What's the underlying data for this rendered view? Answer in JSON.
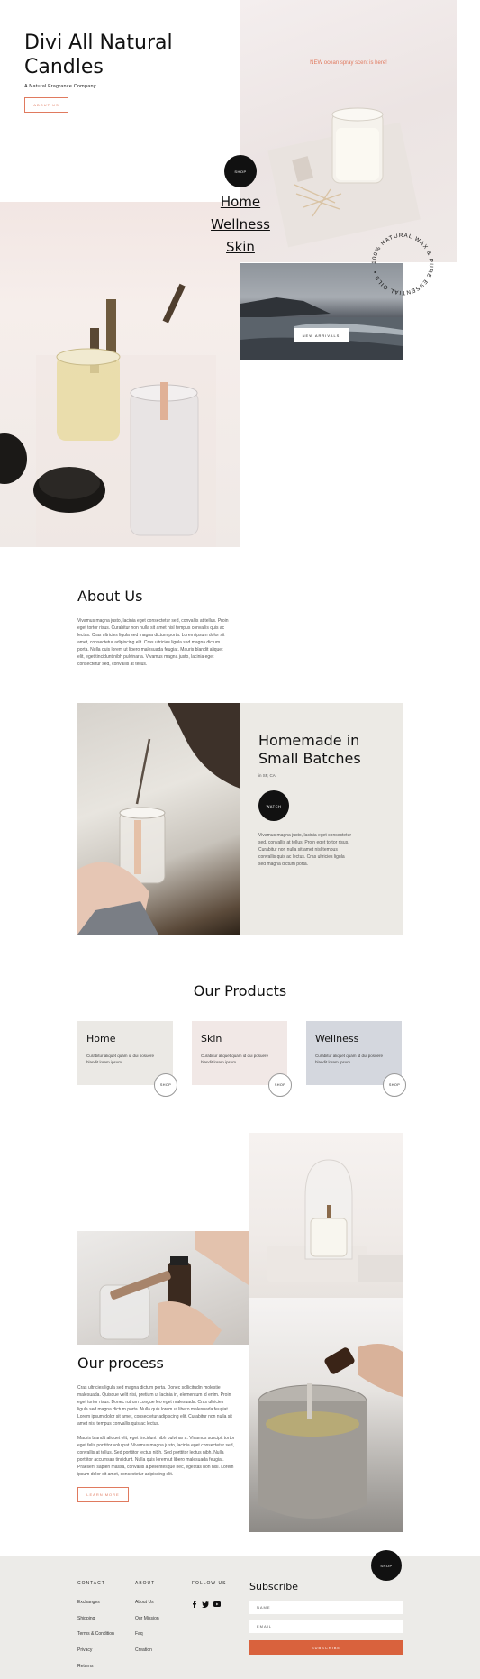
{
  "hero": {
    "title": "Divi All Natural Candles",
    "subtitle": "A Natural Fragrance Company",
    "about_button": "ABOUT US",
    "promo": "NEW ocean spray scent is here!",
    "shop_button": "SHOP",
    "nav": [
      "Home",
      "Wellness",
      "Skin"
    ],
    "new_arrivals_button": "NEW ARRIVALS",
    "circle_text": "100% NATURAL WAX & PURE ESSENTIAL OILS • "
  },
  "about": {
    "title": "About Us",
    "body": "Vivamus magna justo, lacinia eget consectetur sed, convallis at tellus. Proin eget tortor risus. Curabitur non nulla sit amet nisl tempus convallis quis ac lectus. Cras ultricies ligula sed magna dictum porta. Lorem ipsum dolor sit amet, consectetur adipiscing elit. Cras ultricies ligula sed magna dictum porta. Nulla quis lorem ut libero malesuada feugiat. Mauris blandit aliquet elit, eget tincidunt nibh pulvinar a. Vivamus magna justo, lacinia eget consectetur sed, convallis at tellus."
  },
  "homemade": {
    "title": "Homemade in Small Batches",
    "location": "in SF, CA",
    "watch_button": "WATCH",
    "body": "Vivamus magna justo, lacinia eget consectetur sed, convallis at tellus. Proin eget tortor risus. Curabitur non nulla sit amet nisl tempus convallis quis ac lectus. Cras ultricies ligula sed magna dictum porta."
  },
  "products": {
    "title": "Our Products",
    "items": [
      {
        "name": "Home",
        "desc": "Curabitur aliquet quam id dui posuere blandit lorem ipsum.",
        "shop": "SHOP",
        "bg": "#ebe9e5"
      },
      {
        "name": "Skin",
        "desc": "Curabitur aliquet quam id dui posuere blandit lorem ipsum.",
        "shop": "SHOP",
        "bg": "#f1e8e6"
      },
      {
        "name": "Wellness",
        "desc": "Curabitur aliquet quam id dui posuere blandit lorem ipsum.",
        "shop": "SHOP",
        "bg": "#d4d7de"
      }
    ]
  },
  "process": {
    "title": "Our process",
    "body1": "Cras ultricies ligula sed magna dictum porta. Donec sollicitudin molestie malesuada. Quisque velit nisi, pretium ut lacinia in, elementum id enim. Proin eget tortor risus. Donec rutrum congue leo eget malesuada. Cras ultricies ligula sed magna dictum porta. Nulla quis lorem ut libero malesuada feugiat. Lorem ipsum dolor sit amet, consectetur adipiscing elit. Curabitur non nulla sit amet nisl tempus convallis quis ac lectus.",
    "body2": "Mauris blandit aliquet elit, eget tincidunt nibh pulvinar a. Vivamus suscipit tortor eget felis porttitor volutpat. Vivamus magna justo, lacinia eget consectetur sed, convallis at tellus. Sed porttitor lectus nibh. Sed porttitor lectus nibh. Nulla porttitor accumsan tincidunt. Nulla quis lorem ut libero malesuada feugiat. Praesent sapien massa, convallis a pellentesque nec, egestas non nisi. Lorem ipsum dolor sit amet, consectetur adipiscing elit.",
    "button": "LEARN MORE"
  },
  "footer": {
    "shop_button": "SHOP",
    "contact": {
      "heading": "CONTACT",
      "links": [
        "Exchanges",
        "Shipping",
        "Terms & Condition",
        "Privacy",
        "Returns"
      ]
    },
    "about": {
      "heading": "ABOUT",
      "links": [
        "About Us",
        "Our Mission",
        "Faq",
        "Creation"
      ]
    },
    "follow": {
      "heading": "FOLLOW US",
      "icons": [
        "facebook-icon",
        "twitter-icon",
        "youtube-icon"
      ]
    },
    "subscribe": {
      "title": "Subscribe",
      "name_placeholder": "NAME",
      "email_placeholder": "EMAIL",
      "button": "SUBSCRIBE"
    }
  },
  "colors": {
    "accent": "#e07a5f",
    "subscribe": "#d9623d",
    "dark": "#111111"
  }
}
